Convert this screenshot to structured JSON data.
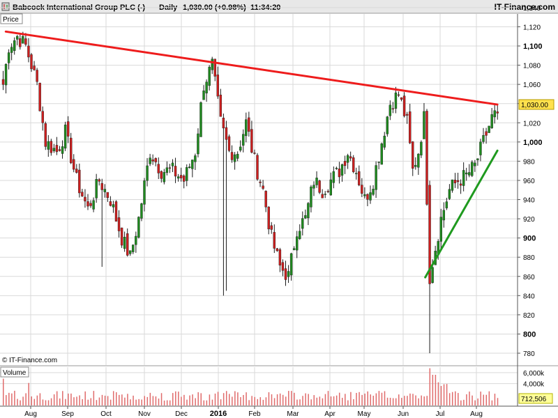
{
  "header": {
    "title": "Babcock International Group PLC (-)",
    "interval": "Daily",
    "last_price": "1,030.00 (+0.98%)",
    "time": "11:34:20",
    "brand": "IT-Finance.com"
  },
  "labels": {
    "price_panel": "Price",
    "volume_panel": "Volume",
    "copyright": "© IT-Finance.com",
    "current_price": "1,030.00",
    "current_volume": "712,506"
  },
  "chart_data": {
    "type": "candlestick",
    "instrument": "Babcock International Group PLC",
    "x_tick_labels": [
      "Aug",
      "Sep",
      "Oct",
      "Nov",
      "Dec",
      "2016",
      "Feb",
      "Mar",
      "Apr",
      "May",
      "Jun",
      "Jul",
      "Aug"
    ],
    "x_tick_bold": [
      false,
      false,
      false,
      false,
      false,
      true,
      false,
      false,
      false,
      false,
      false,
      false,
      false
    ],
    "price_ticks": [
      780,
      800,
      820,
      840,
      860,
      880,
      900,
      920,
      940,
      960,
      980,
      1000,
      1020,
      1040,
      1060,
      1080,
      1100,
      1120,
      1140
    ],
    "price_tick_labels": [
      "780",
      "800",
      "820",
      "840",
      "860",
      "880",
      "900",
      "920",
      "940",
      "960",
      "980",
      "1,000",
      "1,020",
      "1,040",
      "1,060",
      "1,080",
      "1,100",
      "1,120",
      "1,140"
    ],
    "price_tick_bold": [
      false,
      true,
      false,
      false,
      false,
      false,
      true,
      false,
      false,
      false,
      false,
      true,
      false,
      false,
      false,
      false,
      true,
      false,
      false
    ],
    "ylim": [
      770,
      1150
    ],
    "volume_ticks": [
      4000,
      6000
    ],
    "volume_tick_labels": [
      "4,000k",
      "6,000k"
    ],
    "volume_max": 7000,
    "grid": true,
    "price_anchors": [
      [
        0,
        1060
      ],
      [
        2,
        1100
      ],
      [
        5,
        1110
      ],
      [
        8,
        1100
      ],
      [
        12,
        1060
      ],
      [
        15,
        1000
      ],
      [
        19,
        990
      ],
      [
        22,
        1010
      ],
      [
        26,
        960
      ],
      [
        30,
        930
      ],
      [
        34,
        960
      ],
      [
        38,
        940
      ],
      [
        42,
        900
      ],
      [
        45,
        880
      ],
      [
        48,
        920
      ],
      [
        52,
        990
      ],
      [
        56,
        970
      ],
      [
        60,
        970
      ],
      [
        64,
        960
      ],
      [
        68,
        990
      ],
      [
        71,
        1060
      ],
      [
        74,
        1080
      ],
      [
        77,
        1020
      ],
      [
        80,
        990
      ],
      [
        83,
        990
      ],
      [
        86,
        1020
      ],
      [
        89,
        980
      ],
      [
        92,
        950
      ],
      [
        95,
        900
      ],
      [
        98,
        870
      ],
      [
        101,
        860
      ],
      [
        104,
        910
      ],
      [
        107,
        920
      ],
      [
        110,
        960
      ],
      [
        113,
        950
      ],
      [
        116,
        960
      ],
      [
        119,
        970
      ],
      [
        122,
        990
      ],
      [
        125,
        970
      ],
      [
        128,
        940
      ],
      [
        131,
        960
      ],
      [
        134,
        1000
      ],
      [
        137,
        1040
      ],
      [
        140,
        1050
      ],
      [
        143,
        1020
      ],
      [
        145,
        970
      ],
      [
        147,
        990
      ],
      [
        149,
        1025
      ],
      [
        151,
        860
      ],
      [
        153,
        890
      ],
      [
        155,
        920
      ],
      [
        158,
        950
      ],
      [
        161,
        960
      ],
      [
        164,
        965
      ],
      [
        167,
        975
      ],
      [
        170,
        1000
      ],
      [
        173,
        1025
      ],
      [
        175,
        1030
      ]
    ],
    "spike_lows": [
      [
        35,
        870
      ],
      [
        78,
        840
      ],
      [
        79,
        845
      ],
      [
        151,
        780
      ]
    ],
    "trendlines": [
      {
        "name": "resistance",
        "color": "#ee1c1c",
        "from": [
          "2015-07-17",
          1115
        ],
        "to": [
          "2016-08-22",
          1039
        ]
      },
      {
        "name": "support",
        "color": "#1f9a1f",
        "from": [
          "2016-06-24",
          859
        ],
        "to": [
          "2016-08-22",
          991
        ]
      }
    ],
    "current_price": 1030.0,
    "change_pct": 0.98
  },
  "colors": {
    "up": "#1f8a1f",
    "down": "#cc1f1f",
    "grid": "#d9d9d9",
    "price_tag": "#ffe14d",
    "volume_tag": "#ffff99",
    "volume_bar": "#e06b6b"
  }
}
